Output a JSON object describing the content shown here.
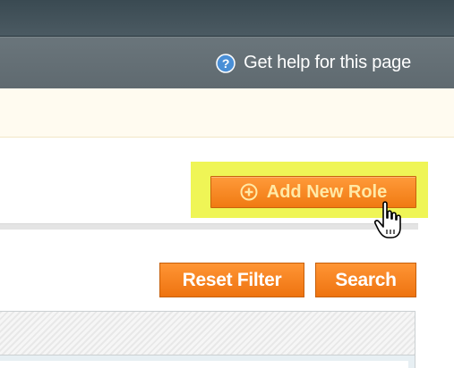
{
  "help": {
    "label": "Get help for this page",
    "icon": "help-icon"
  },
  "toolbar": {
    "add_role_label": "Add New Role",
    "add_role_icon": "plus-circle-icon"
  },
  "filters": {
    "reset_label": "Reset Filter",
    "search_label": "Search"
  },
  "colors": {
    "header_dark": "#3a4a52",
    "help_bar": "#667177",
    "notice_bg": "#fffbf0",
    "accent_orange": "#f07a12",
    "highlight": "#eef44d"
  }
}
